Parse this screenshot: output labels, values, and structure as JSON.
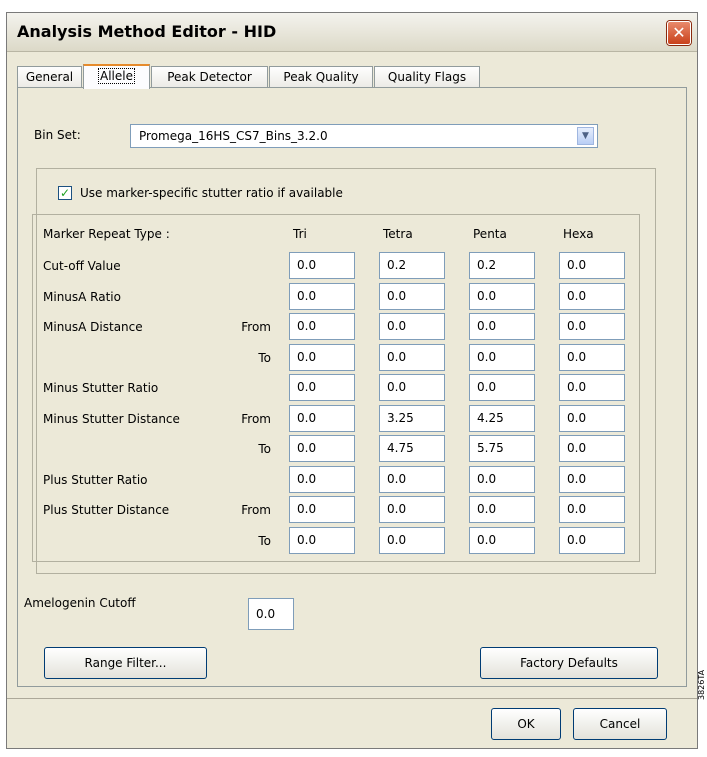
{
  "window": {
    "title": "Analysis Method Editor - HID",
    "close_symbol": "✕"
  },
  "tabs": [
    {
      "label": "General",
      "active": false
    },
    {
      "label": "Allele",
      "active": true
    },
    {
      "label": "Peak Detector",
      "active": false
    },
    {
      "label": "Peak Quality",
      "active": false
    },
    {
      "label": "Quality Flags",
      "active": false
    }
  ],
  "bin_set": {
    "label": "Bin Set:",
    "value": "Promega_16HS_CS7_Bins_3.2.0"
  },
  "stutter_checkbox": {
    "label": "Use marker-specific stutter ratio if available",
    "checked": true
  },
  "grid": {
    "header_label": "Marker Repeat Type :",
    "columns": [
      "Tri",
      "Tetra",
      "Penta",
      "Hexa"
    ],
    "rows": [
      {
        "label": "Cut-off Value",
        "sub": "",
        "values": [
          "0.0",
          "0.2",
          "0.2",
          "0.0"
        ]
      },
      {
        "label": "MinusA Ratio",
        "sub": "",
        "values": [
          "0.0",
          "0.0",
          "0.0",
          "0.0"
        ]
      },
      {
        "label": "MinusA Distance",
        "sub": "From",
        "values": [
          "0.0",
          "0.0",
          "0.0",
          "0.0"
        ]
      },
      {
        "label": "",
        "sub": "To",
        "values": [
          "0.0",
          "0.0",
          "0.0",
          "0.0"
        ]
      },
      {
        "label": "Minus Stutter Ratio",
        "sub": "",
        "values": [
          "0.0",
          "0.0",
          "0.0",
          "0.0"
        ]
      },
      {
        "label": "Minus Stutter Distance",
        "sub": "From",
        "values": [
          "0.0",
          "3.25",
          "4.25",
          "0.0"
        ]
      },
      {
        "label": "",
        "sub": "To",
        "values": [
          "0.0",
          "4.75",
          "5.75",
          "0.0"
        ]
      },
      {
        "label": "Plus Stutter Ratio",
        "sub": "",
        "values": [
          "0.0",
          "0.0",
          "0.0",
          "0.0"
        ]
      },
      {
        "label": "Plus Stutter Distance",
        "sub": "From",
        "values": [
          "0.0",
          "0.0",
          "0.0",
          "0.0"
        ]
      },
      {
        "label": "",
        "sub": "To",
        "values": [
          "0.0",
          "0.0",
          "0.0",
          "0.0"
        ]
      }
    ]
  },
  "amelogenin": {
    "label": "Amelogenin Cutoff",
    "value": "0.0"
  },
  "buttons": {
    "range_filter": "Range Filter...",
    "factory_defaults": "Factory Defaults",
    "ok": "OK",
    "cancel": "Cancel"
  },
  "side_code": "3826TA"
}
